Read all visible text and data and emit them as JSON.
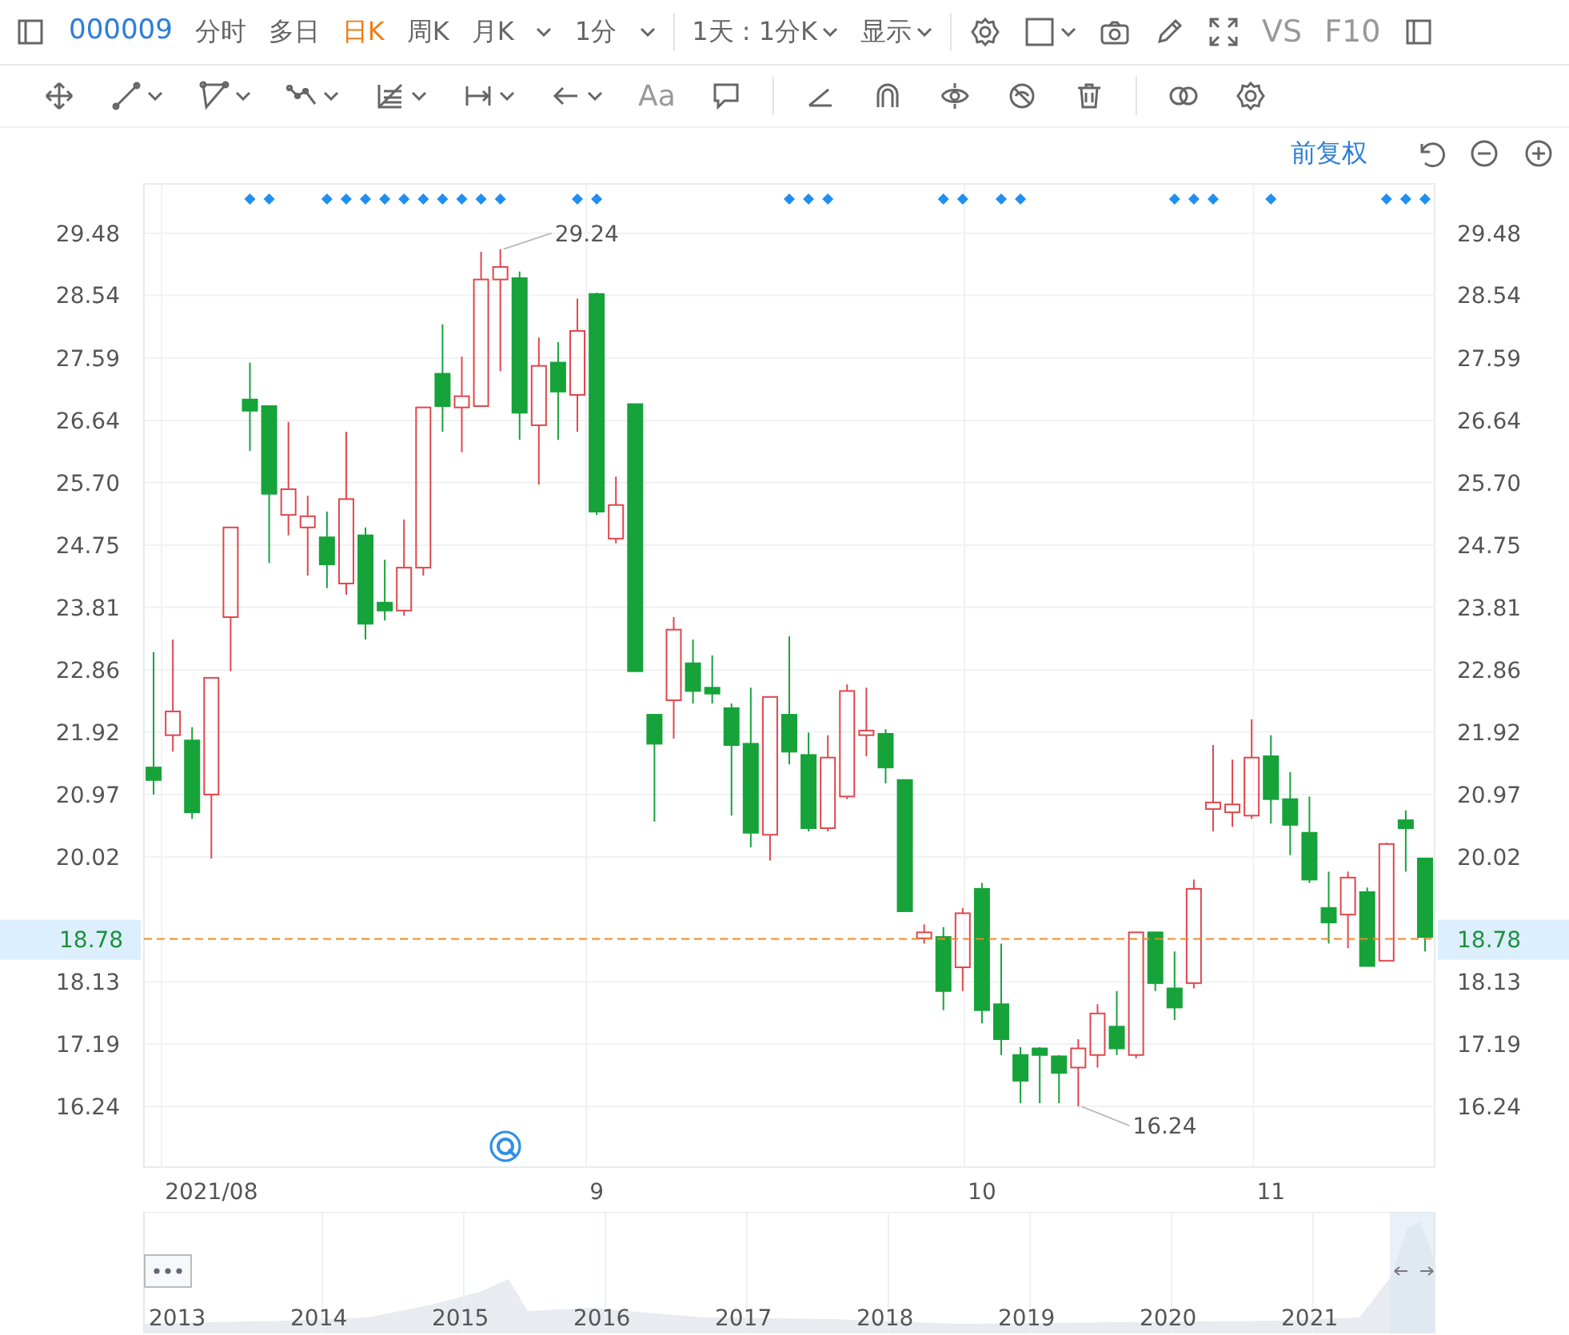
{
  "toolbar": {
    "stock_code": "000009",
    "periods": [
      {
        "label": "分时",
        "selected": false,
        "kind": "tab"
      },
      {
        "label": "多日",
        "selected": false,
        "kind": "tab"
      },
      {
        "label": "日K",
        "selected": true,
        "kind": "tab"
      },
      {
        "label": "周K",
        "selected": false,
        "kind": "tab"
      },
      {
        "label": "月K",
        "selected": false,
        "kind": "dropdown"
      },
      {
        "label": "1分",
        "selected": false,
        "kind": "dropdown"
      }
    ],
    "range_select": "1天 : 1分K",
    "display_select": "显示",
    "compare": "VS",
    "f10": "F10"
  },
  "drawing_tools": {
    "text_tool": "Aa"
  },
  "adjust_mode": "前复权",
  "chart": {
    "right_axis_labels": [
      "29.48",
      "28.54",
      "27.59",
      "26.64",
      "25.70",
      "24.75",
      "23.81",
      "22.86",
      "21.92",
      "20.97",
      "20.02",
      "18.13",
      "17.19",
      "16.24"
    ],
    "price_tags": [
      "18.78"
    ],
    "event_flags": [
      false,
      false,
      false,
      false,
      false,
      true,
      true,
      false,
      false,
      true,
      true,
      true,
      true,
      true,
      true,
      true,
      true,
      true,
      true,
      false,
      false,
      false,
      true,
      true,
      false,
      false,
      false,
      false,
      false,
      false,
      false,
      false,
      false,
      true,
      true,
      true,
      false,
      false,
      false,
      false,
      false,
      true,
      true,
      false,
      true,
      true,
      false,
      false,
      false,
      false,
      false,
      false,
      false,
      true,
      true,
      true,
      false,
      false,
      true,
      false,
      false,
      false,
      false,
      false,
      true,
      true,
      true
    ],
    "chart_data": {
      "type": "candlestick",
      "grid": true,
      "ylim": [
        15.32,
        30.23
      ],
      "yticks": [
        {
          "value": 29.48,
          "label": "29.48"
        },
        {
          "value": 28.54,
          "label": "28.54"
        },
        {
          "value": 27.59,
          "label": "27.59"
        },
        {
          "value": 26.64,
          "label": "26.64"
        },
        {
          "value": 25.7,
          "label": "25.70"
        },
        {
          "value": 24.75,
          "label": "24.75"
        },
        {
          "value": 23.81,
          "label": "23.81"
        },
        {
          "value": 22.86,
          "label": "22.86"
        },
        {
          "value": 21.92,
          "label": "21.92"
        },
        {
          "value": 20.97,
          "label": "20.97"
        },
        {
          "value": 20.02,
          "label": "20.02"
        },
        {
          "value": 18.13,
          "label": "18.13"
        },
        {
          "value": 17.19,
          "label": "17.19"
        },
        {
          "value": 16.24,
          "label": "16.24"
        }
      ],
      "categories": [
        null,
        null,
        null,
        "2021/08",
        null,
        null,
        null,
        null,
        null,
        null,
        null,
        null,
        null,
        null,
        null,
        null,
        null,
        null,
        null,
        null,
        null,
        null,
        null,
        "9",
        null,
        null,
        null,
        null,
        null,
        null,
        null,
        null,
        null,
        null,
        null,
        null,
        null,
        null,
        null,
        null,
        null,
        null,
        null,
        "10",
        null,
        null,
        null,
        null,
        null,
        null,
        null,
        null,
        null,
        null,
        null,
        null,
        null,
        null,
        "11",
        null,
        null,
        null,
        null,
        null,
        null,
        null,
        null
      ],
      "ohlc": [
        [
          21.38,
          23.13,
          20.97,
          21.19
        ],
        [
          21.87,
          23.32,
          21.62,
          22.23
        ],
        [
          21.79,
          21.99,
          20.6,
          20.7
        ],
        [
          20.97,
          22.74,
          20.0,
          22.74
        ],
        [
          23.66,
          25.02,
          22.84,
          25.02
        ],
        [
          26.96,
          27.52,
          26.18,
          26.79
        ],
        [
          26.86,
          26.86,
          24.48,
          25.53
        ],
        [
          25.21,
          26.62,
          24.9,
          25.6
        ],
        [
          25.02,
          25.5,
          24.29,
          25.19
        ],
        [
          24.87,
          25.26,
          24.1,
          24.46
        ],
        [
          24.17,
          26.47,
          24.0,
          25.45
        ],
        [
          24.9,
          25.02,
          23.32,
          23.56
        ],
        [
          23.88,
          24.53,
          23.61,
          23.76
        ],
        [
          23.76,
          25.14,
          23.68,
          24.41
        ],
        [
          24.41,
          26.84,
          24.29,
          26.84
        ],
        [
          27.35,
          28.1,
          26.47,
          26.86
        ],
        [
          26.84,
          27.61,
          26.16,
          27.01
        ],
        [
          26.86,
          29.2,
          26.86,
          28.78
        ],
        [
          28.78,
          29.24,
          27.39,
          28.97
        ],
        [
          28.8,
          28.9,
          26.35,
          26.76
        ],
        [
          26.57,
          27.9,
          25.67,
          27.47
        ],
        [
          27.52,
          27.83,
          26.35,
          27.08
        ],
        [
          27.03,
          28.49,
          26.47,
          28.0
        ],
        [
          28.56,
          28.58,
          25.21,
          25.26
        ],
        [
          24.85,
          25.79,
          24.78,
          25.36
        ],
        [
          26.89,
          26.89,
          22.84,
          22.84
        ],
        [
          22.18,
          22.18,
          20.56,
          21.74
        ],
        [
          22.4,
          23.66,
          21.82,
          23.47
        ],
        [
          22.96,
          23.32,
          22.35,
          22.54
        ],
        [
          22.59,
          23.08,
          22.35,
          22.5
        ],
        [
          22.28,
          22.35,
          20.65,
          21.72
        ],
        [
          21.74,
          22.59,
          20.17,
          20.39
        ],
        [
          20.36,
          22.45,
          19.97,
          22.45
        ],
        [
          22.18,
          23.37,
          21.43,
          21.62
        ],
        [
          21.57,
          21.91,
          20.41,
          20.46
        ],
        [
          20.46,
          21.87,
          20.41,
          21.53
        ],
        [
          20.94,
          22.64,
          20.9,
          22.54
        ],
        [
          21.87,
          22.59,
          21.55,
          21.94
        ],
        [
          21.89,
          21.96,
          21.14,
          21.38
        ],
        [
          21.19,
          21.19,
          19.2,
          19.2
        ],
        [
          18.79,
          19.0,
          18.71,
          18.88
        ],
        [
          18.81,
          18.96,
          17.7,
          17.99
        ],
        [
          18.35,
          19.25,
          17.99,
          19.17
        ],
        [
          19.54,
          19.63,
          17.5,
          17.7
        ],
        [
          17.79,
          18.71,
          17.02,
          17.26
        ],
        [
          17.02,
          17.14,
          16.29,
          16.63
        ],
        [
          17.12,
          17.14,
          16.29,
          17.02
        ],
        [
          17.0,
          17.02,
          16.29,
          16.75
        ],
        [
          16.83,
          17.26,
          16.24,
          17.12
        ],
        [
          17.02,
          17.79,
          16.83,
          17.65
        ],
        [
          17.45,
          17.99,
          17.02,
          17.12
        ],
        [
          17.02,
          18.88,
          16.97,
          18.88
        ],
        [
          18.88,
          18.88,
          17.99,
          18.11
        ],
        [
          18.03,
          18.59,
          17.55,
          17.74
        ],
        [
          18.11,
          19.68,
          18.03,
          19.54
        ],
        [
          20.75,
          21.72,
          20.41,
          20.85
        ],
        [
          20.7,
          21.5,
          20.48,
          20.82
        ],
        [
          20.65,
          22.11,
          20.6,
          21.53
        ],
        [
          21.55,
          21.87,
          20.53,
          20.9
        ],
        [
          20.9,
          21.31,
          20.05,
          20.51
        ],
        [
          20.39,
          20.94,
          19.63,
          19.68
        ],
        [
          19.25,
          19.8,
          18.71,
          19.03
        ],
        [
          19.15,
          19.8,
          18.64,
          19.71
        ],
        [
          19.49,
          19.56,
          18.37,
          18.37
        ],
        [
          18.45,
          20.24,
          18.45,
          20.22
        ],
        [
          20.58,
          20.73,
          19.8,
          20.46
        ],
        [
          20.0,
          20.0,
          18.59,
          18.81
        ]
      ],
      "ref_lines": [
        {
          "axis": "y",
          "value": 18.78,
          "label": "18.78"
        }
      ],
      "annotations": [
        "29.24",
        "16.24"
      ]
    }
  },
  "navigator": {
    "years": [
      "2013",
      "2014",
      "2015",
      "2016",
      "2017",
      "2018",
      "2019",
      "2020",
      "2021"
    ]
  }
}
